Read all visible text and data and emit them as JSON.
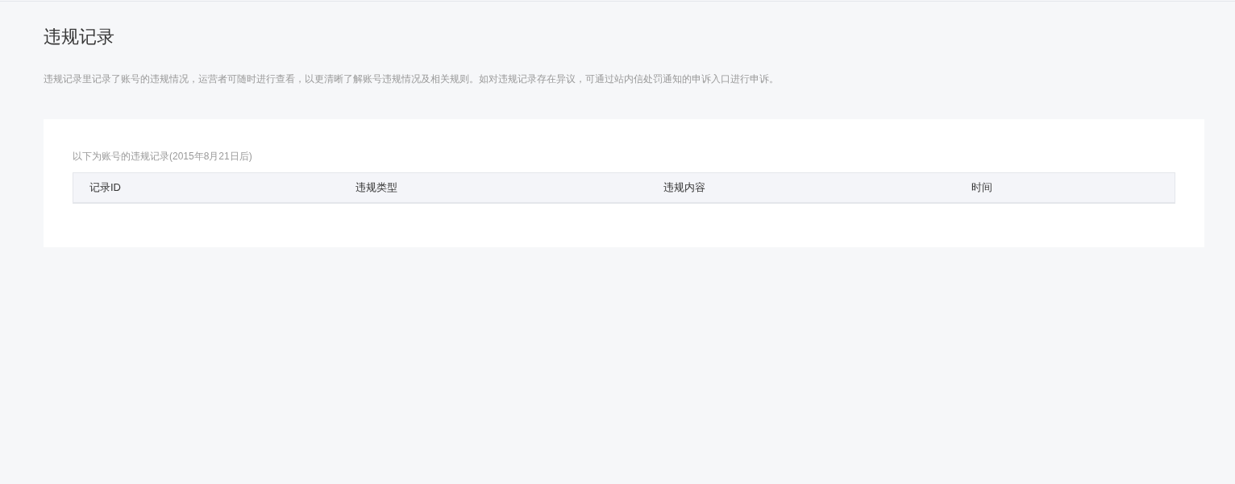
{
  "page": {
    "title": "违规记录",
    "description": "违规记录里记录了账号的违规情况，运营者可随时进行查看，以更清晰了解账号违规情况及相关规则。如对违规记录存在异议，可通过站内信处罚通知的申诉入口进行申诉。"
  },
  "records": {
    "caption": "以下为账号的违规记录(2015年8月21日后)",
    "table": {
      "columns": [
        "记录ID",
        "违规类型",
        "违规内容",
        "时间"
      ]
    }
  }
}
